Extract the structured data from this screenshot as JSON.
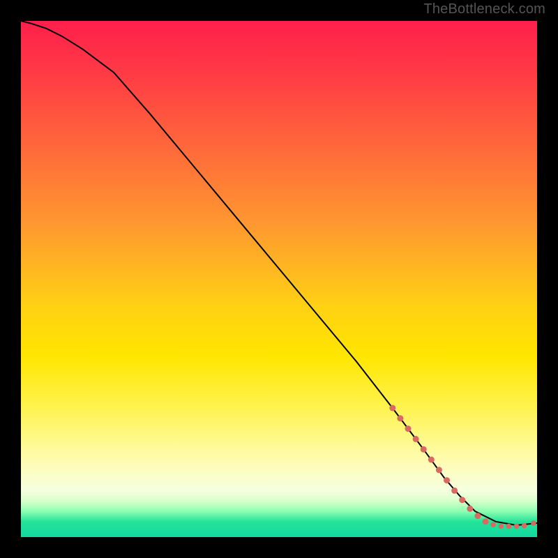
{
  "attribution": "TheBottleneck.com",
  "chart_data": {
    "type": "line",
    "title": "",
    "xlabel": "",
    "ylabel": "",
    "xlim": [
      0,
      100
    ],
    "ylim": [
      0,
      100
    ],
    "series": [
      {
        "name": "curve",
        "x": [
          0,
          2,
          5,
          8,
          12,
          18,
          25,
          35,
          45,
          55,
          65,
          72,
          78,
          82,
          85,
          88,
          92,
          96,
          100
        ],
        "y": [
          100,
          99.5,
          98.5,
          97,
          94.5,
          90,
          82,
          70,
          58,
          46,
          34,
          25,
          17,
          11.5,
          8,
          5,
          3,
          2.3,
          2.7
        ]
      }
    ],
    "markers": [
      {
        "x": 72,
        "y": 25,
        "r": 4.5
      },
      {
        "x": 73.5,
        "y": 23,
        "r": 4.5
      },
      {
        "x": 75,
        "y": 21,
        "r": 4.5
      },
      {
        "x": 76.5,
        "y": 19,
        "r": 4.5
      },
      {
        "x": 78,
        "y": 17,
        "r": 4.5
      },
      {
        "x": 79.5,
        "y": 15,
        "r": 4.5
      },
      {
        "x": 81,
        "y": 13,
        "r": 4.5
      },
      {
        "x": 82.5,
        "y": 11,
        "r": 4.5
      },
      {
        "x": 84,
        "y": 9,
        "r": 4.5
      },
      {
        "x": 85.5,
        "y": 7.2,
        "r": 4.5
      },
      {
        "x": 87,
        "y": 5.5,
        "r": 4.5
      },
      {
        "x": 88.5,
        "y": 4.1,
        "r": 4.5
      },
      {
        "x": 90,
        "y": 3.0,
        "r": 4.5
      },
      {
        "x": 91.5,
        "y": 2.4,
        "r": 3.8
      },
      {
        "x": 93,
        "y": 2.1,
        "r": 3.8
      },
      {
        "x": 94.5,
        "y": 2.1,
        "r": 3.8
      },
      {
        "x": 96,
        "y": 2.1,
        "r": 3.8
      },
      {
        "x": 97.5,
        "y": 2.2,
        "r": 3.8
      },
      {
        "x": 99.3,
        "y": 2.7,
        "r": 3.8
      }
    ],
    "marker_color": "#d96a62",
    "line_color": "#000000"
  }
}
